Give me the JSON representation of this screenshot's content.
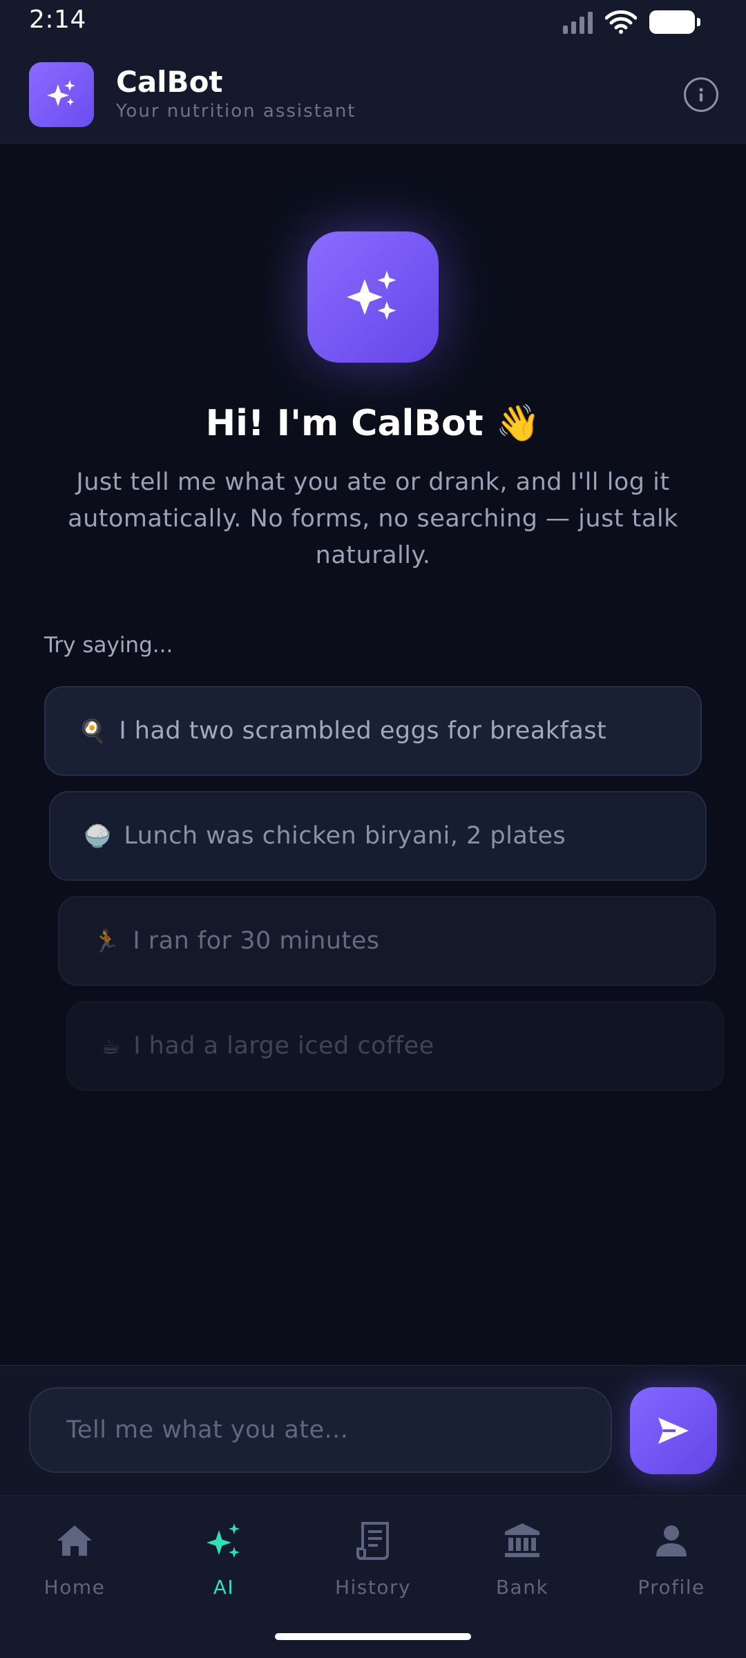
{
  "status_bar": {
    "time": "2:14"
  },
  "header": {
    "title": "CalBot",
    "subtitle": "Your nutrition assistant",
    "logo_icon": "sparkles-icon",
    "info_icon": "info-icon"
  },
  "hero": {
    "icon": "sparkles-icon",
    "title": "Hi! I'm CalBot 👋",
    "description": "Just tell me what you ate or drank, and I'll log it automatically. No forms, no searching — just talk naturally."
  },
  "suggestions": {
    "label": "Try saying...",
    "items": [
      {
        "emoji": "🍳",
        "text": "I had two scrambled eggs for breakfast"
      },
      {
        "emoji": "🍚",
        "text": "Lunch was chicken biryani, 2 plates"
      },
      {
        "emoji": "🏃",
        "text": "I ran for 30 minutes"
      },
      {
        "emoji": "☕",
        "text": "I had a large iced coffee"
      }
    ]
  },
  "composer": {
    "placeholder": "Tell me what you ate...",
    "send_icon": "send-icon"
  },
  "nav": {
    "items": [
      {
        "label": "Home",
        "icon": "home-icon"
      },
      {
        "label": "AI",
        "icon": "sparkles-icon",
        "active": true
      },
      {
        "label": "History",
        "icon": "receipt-icon"
      },
      {
        "label": "Bank",
        "icon": "bank-icon"
      },
      {
        "label": "Profile",
        "icon": "user-icon"
      }
    ]
  },
  "colors": {
    "background": "#0b0e1a",
    "panel": "#141a2b",
    "accent_purple": "#7a5cff",
    "active_nav": "#2fe0b4"
  }
}
